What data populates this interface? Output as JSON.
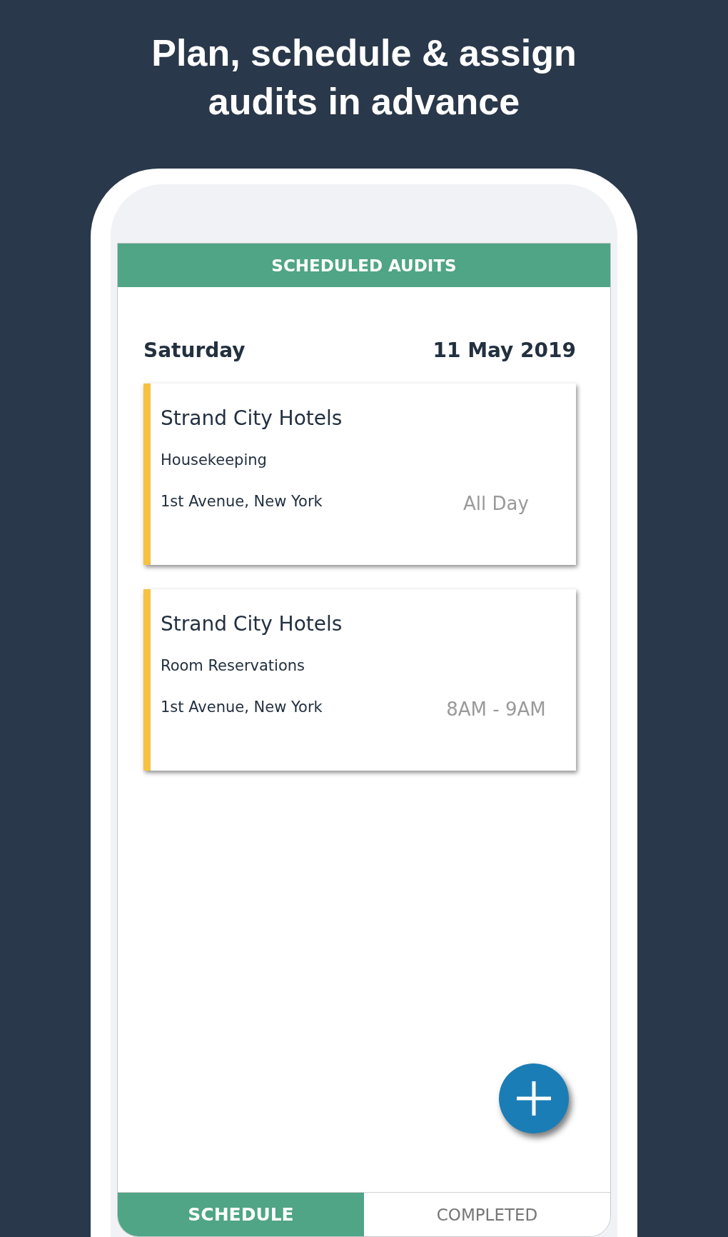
{
  "headline": "Plan, schedule & assign audits in advance",
  "screen": {
    "title": "SCHEDULED AUDITS",
    "day": "Saturday",
    "date": "11 May 2019",
    "audits": [
      {
        "title": "Strand City Hotels",
        "department": "Housekeeping",
        "address": "1st Avenue, New York",
        "time": "All Day"
      },
      {
        "title": "Strand City Hotels",
        "department": "Room Reservations",
        "address": "1st Avenue, New York",
        "time": "8AM - 9AM"
      }
    ],
    "tabs": [
      {
        "label": "SCHEDULE",
        "selected": true
      },
      {
        "label": "COMPLETED",
        "selected": false
      }
    ]
  }
}
